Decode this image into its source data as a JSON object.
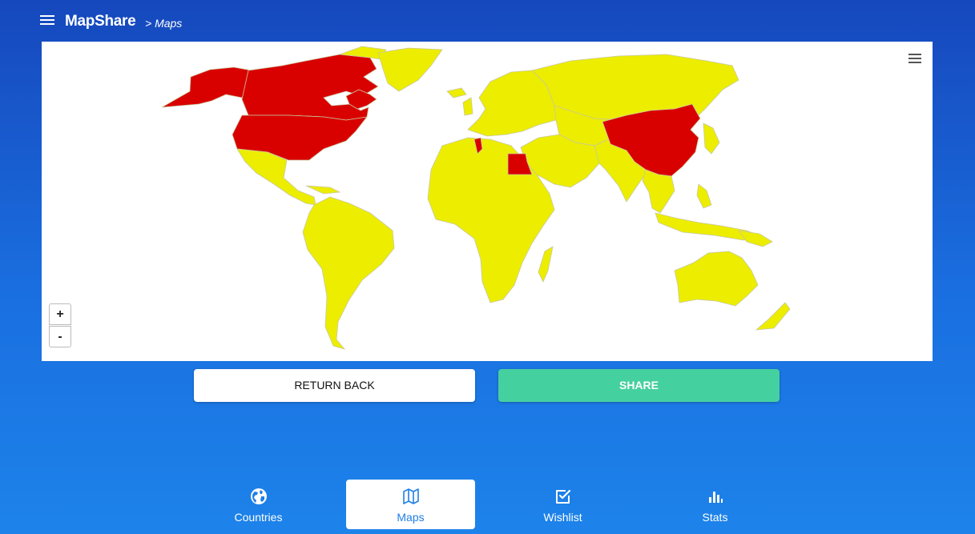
{
  "app": {
    "title": "MapShare",
    "breadcrumb": "> Maps"
  },
  "map": {
    "zoom_in_label": "+",
    "zoom_out_label": "-",
    "visited_color": "#d90000",
    "unvisited_color": "#eded00",
    "visited_countries": [
      "United States",
      "Canada",
      "China",
      "Egypt",
      "Tunisia"
    ]
  },
  "actions": {
    "return_label": "RETURN BACK",
    "share_label": "SHARE"
  },
  "tabs": [
    {
      "label": "Countries",
      "icon": "globe-icon",
      "active": false
    },
    {
      "label": "Maps",
      "icon": "map-icon",
      "active": true
    },
    {
      "label": "Wishlist",
      "icon": "checkbox-icon",
      "active": false
    },
    {
      "label": "Stats",
      "icon": "bar-chart-icon",
      "active": false
    }
  ]
}
